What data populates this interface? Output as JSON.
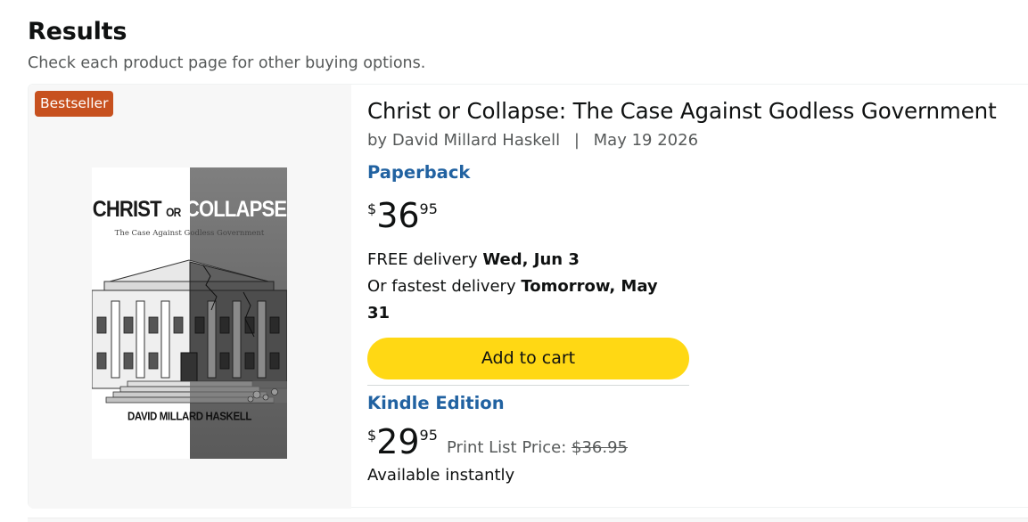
{
  "header": {
    "title": "Results",
    "subtitle": "Check each product page for other buying options."
  },
  "product": {
    "badge": "Bestseller",
    "title": "Christ or Collapse: The Case Against Godless Government",
    "byline_prefix": "by",
    "author": "David Millard Haskell",
    "separator": "|",
    "date": "May 19 2026",
    "cover": {
      "title_word1": "CHRIST",
      "title_word2": "OR",
      "title_word3": "COLLAPSE",
      "subtitle": "The Case Against Godless Government",
      "author": "DAVID MILLARD HASKELL"
    },
    "paperback": {
      "format": "Paperback",
      "currency": "$",
      "price_whole": "36",
      "price_fraction": "95",
      "delivery_prefix": "FREE delivery",
      "delivery_date": "Wed, Jun 3",
      "fastest_prefix": "Or fastest delivery",
      "fastest_date_line1": "Tomorrow, May",
      "fastest_date_line2": "31",
      "add_to_cart": "Add to cart"
    },
    "kindle": {
      "format": "Kindle Edition",
      "currency": "$",
      "price_whole": "29",
      "price_fraction": "95",
      "list_price_label": "Print List Price:",
      "list_price": "$36.95",
      "availability": "Available instantly"
    }
  },
  "colors": {
    "badge": "#c7511f",
    "link": "#2162a1",
    "cart_button": "#ffd814",
    "text": "#0f1111",
    "muted": "#565959"
  }
}
